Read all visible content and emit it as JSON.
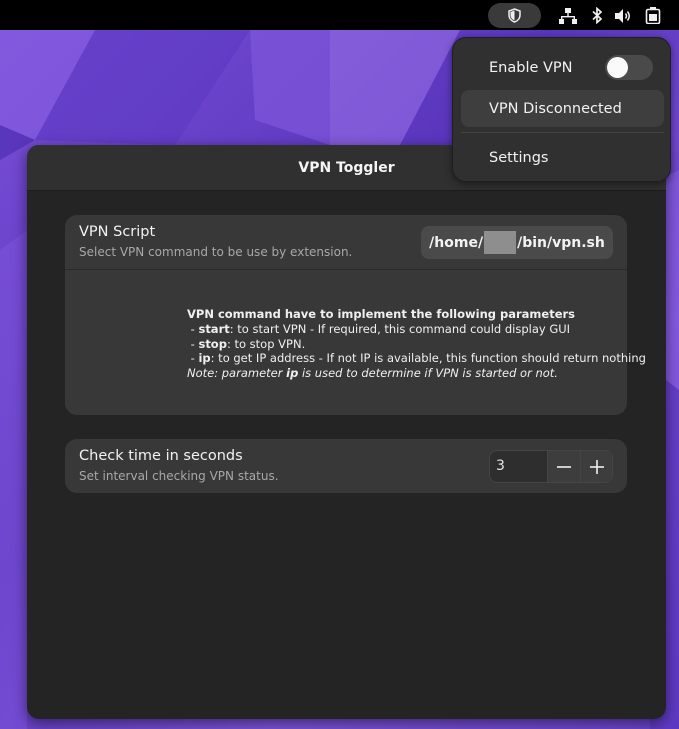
{
  "topbar": {
    "indicator_icon": "shield-icon",
    "tray_icons": [
      "network-wired-icon",
      "bluetooth-icon",
      "volume-icon",
      "battery-icon"
    ]
  },
  "quick_menu": {
    "enable_vpn_label": "Enable VPN",
    "enable_vpn_on": false,
    "status_label": "VPN Disconnected",
    "settings_label": "Settings"
  },
  "window": {
    "title": "VPN Toggler",
    "script_row": {
      "title": "VPN Script",
      "subtitle": "Select VPN command to be use by extension.",
      "path_prefix": "/home/",
      "path_suffix": "/bin/vpn.sh"
    },
    "help": {
      "heading": "VPN command have to implement the following parameters",
      "start_param": "start",
      "start_desc": ": to start VPN - If required, this command could display GUI",
      "stop_param": "stop",
      "stop_desc": ": to stop VPN.",
      "ip_param": "ip",
      "ip_desc": ": to get IP address - If not IP is available, this function should return nothing",
      "note_prefix": "Note: parameter ",
      "note_param": "ip",
      "note_suffix": " is used to determine if VPN is started or not."
    },
    "interval_row": {
      "title": "Check time in seconds",
      "subtitle": "Set interval checking VPN status.",
      "value": "3",
      "decrement_icon": "minus-icon",
      "increment_icon": "plus-icon"
    }
  },
  "colors": {
    "wallpaper": "#6a3fc9",
    "topbar": "#000000",
    "window_bg": "#242424",
    "card_bg": "#383838"
  }
}
